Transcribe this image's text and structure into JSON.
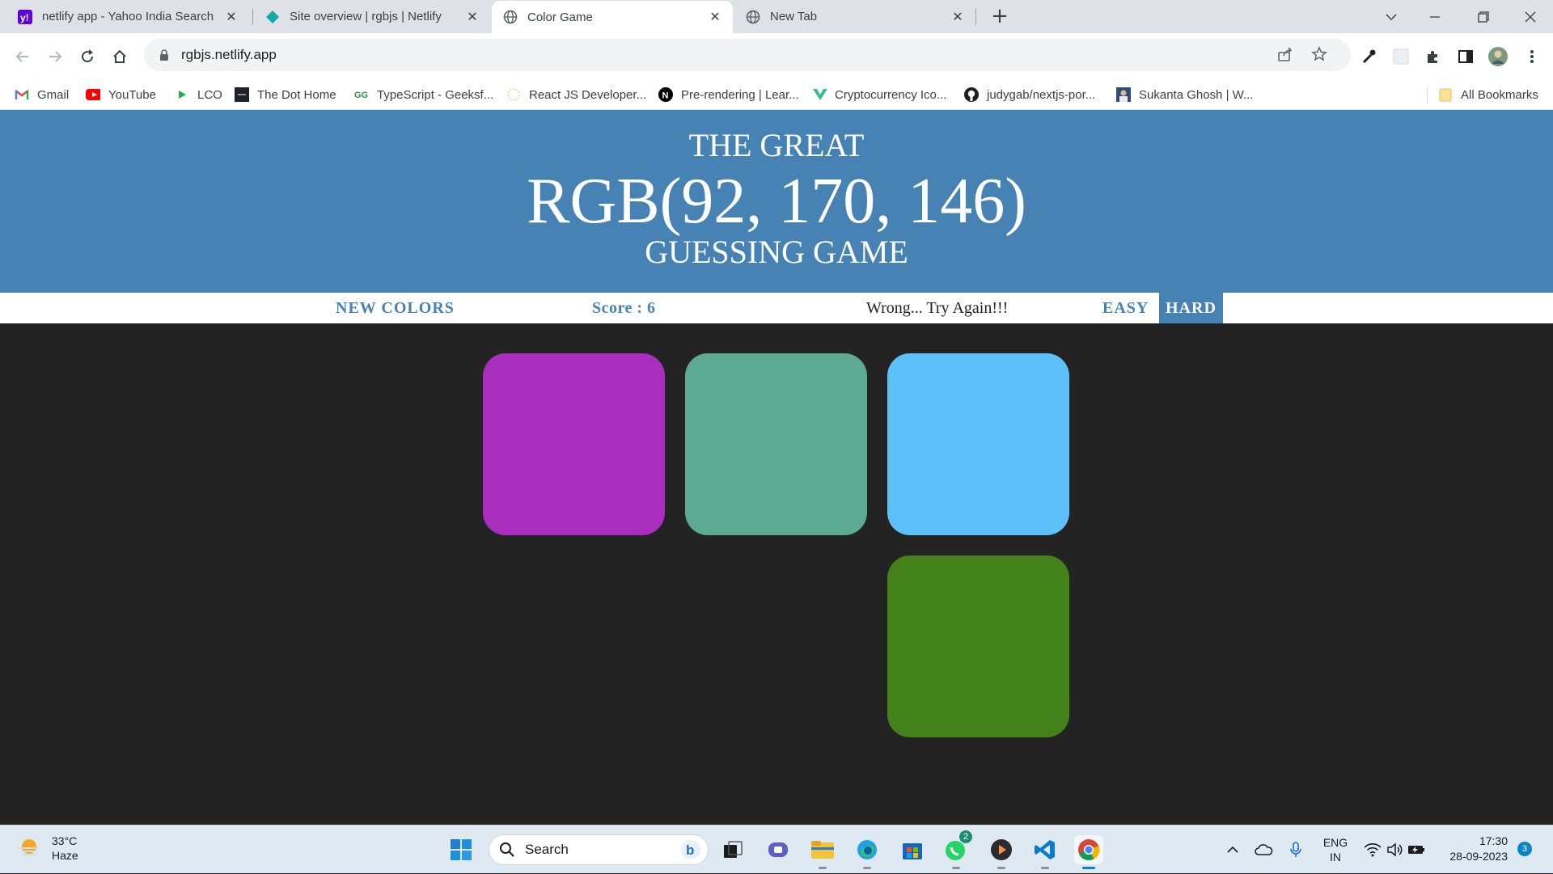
{
  "browser": {
    "tabs": [
      {
        "title": "netlify app - Yahoo India Search",
        "icon": "yahoo-icon",
        "close": "✕"
      },
      {
        "title": "Site overview | rgbjs | Netlify",
        "icon": "netlify-icon",
        "close": "✕"
      },
      {
        "title": "Color Game",
        "icon": "globe-icon",
        "close": "✕"
      },
      {
        "title": "New Tab",
        "icon": "globe-icon",
        "close": "✕"
      }
    ],
    "new_tab": "+",
    "url": "rgbjs.netlify.app",
    "bookmarks": [
      {
        "label": "Gmail",
        "icon": "gmail-icon"
      },
      {
        "label": "YouTube",
        "icon": "youtube-icon"
      },
      {
        "label": "LCO",
        "icon": "lco-icon"
      },
      {
        "label": "The Dot Home",
        "icon": "dot-home-icon"
      },
      {
        "label": "TypeScript - Geeksf...",
        "icon": "geeksforgeeks-icon"
      },
      {
        "label": "React JS Developer...",
        "icon": "react-dev-icon"
      },
      {
        "label": "Pre-rendering | Lear...",
        "icon": "nextjs-icon"
      },
      {
        "label": "Cryptocurrency Ico...",
        "icon": "crypto-icon"
      },
      {
        "label": "judygab/nextjs-por...",
        "icon": "github-icon"
      },
      {
        "label": "Sukanta Ghosh | W...",
        "icon": "profile-icon"
      }
    ],
    "all_bookmarks": "All Bookmarks"
  },
  "game": {
    "title_top": "THE GREAT",
    "target_rgb": "RGB(92, 170, 146)",
    "title_bottom": "GUESSING GAME",
    "new_colors": "NEW COLORS",
    "score": "Score : 6",
    "message": "Wrong... Try Again!!!",
    "mode_easy": "EASY",
    "mode_hard": "HARD",
    "selected_mode": "HARD",
    "squares": [
      {
        "color": "#aa2ebd"
      },
      {
        "color": "#5caa92"
      },
      {
        "color": "#5ec0f8"
      },
      {
        "color": null
      },
      {
        "color": null
      },
      {
        "color": "#43811a"
      }
    ],
    "hero_color": "#4682b4",
    "page_bg": "#232323"
  },
  "taskbar": {
    "temperature": "33°C",
    "weather": "Haze",
    "search_placeholder": "Search",
    "whatsapp_badge": "2",
    "lang": "ENG",
    "region": "IN",
    "time": "17:30",
    "date": "28-09-2023",
    "notification_count": "3"
  }
}
